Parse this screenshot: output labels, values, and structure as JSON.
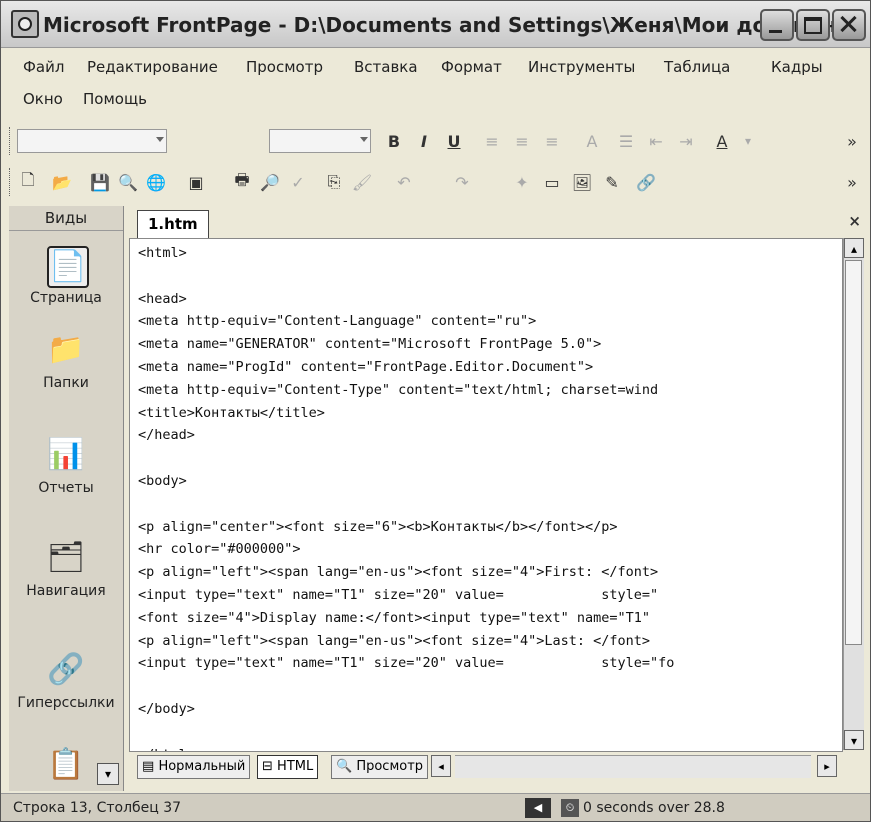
{
  "window": {
    "title": "Microsoft FrontPage - D:\\Documents and Settings\\Женя\\Мои докумен..."
  },
  "menu": {
    "items": [
      "Файл",
      "Редактирование",
      "Просмотр",
      "Вставка",
      "Формат",
      "Инструменты",
      "Таблица",
      "Кадры",
      "Окно",
      "Помощь"
    ]
  },
  "toolbar": {
    "bold": "B",
    "italic": "I",
    "underline": "U",
    "more": "»"
  },
  "views": {
    "header": "Виды",
    "items": [
      {
        "label": "Страница",
        "icon": "page-icon"
      },
      {
        "label": "Папки",
        "icon": "folders-icon"
      },
      {
        "label": "Отчеты",
        "icon": "reports-icon"
      },
      {
        "label": "Навигация",
        "icon": "navigation-icon"
      },
      {
        "label": "Гиперссылки",
        "icon": "hyperlinks-icon"
      }
    ]
  },
  "editor": {
    "tab_label": "1.htm",
    "close_glyph": "×",
    "lines": [
      "<html>",
      "",
      "<head>",
      "<meta http-equiv=\"Content-Language\" content=\"ru\">",
      "<meta name=\"GENERATOR\" content=\"Microsoft FrontPage 5.0\">",
      "<meta name=\"ProgId\" content=\"FrontPage.Editor.Document\">",
      "<meta http-equiv=\"Content-Type\" content=\"text/html; charset=wind",
      "<title>Контакты</title>",
      "</head>",
      "",
      "<body>",
      "",
      "<p align=\"center\"><font size=\"6\"><b>Контакты</b></font></p>",
      "<hr color=\"#000000\">",
      "<p align=\"left\"><span lang=\"en-us\"><font size=\"4\">First: </font>",
      "<input type=\"text\" name=\"T1\" size=\"20\" value=            style=\"",
      "<font size=\"4\">Display name:</font><input type=\"text\" name=\"T1\" ",
      "<p align=\"left\"><span lang=\"en-us\"><font size=\"4\">Last: </font>",
      "<input type=\"text\" name=\"T1\" size=\"20\" value=            style=\"fo",
      "",
      "</body>",
      "",
      "</html>"
    ]
  },
  "view_tabs": {
    "normal": "Нормальный",
    "html": "HTML",
    "preview": "Просмотр"
  },
  "status": {
    "position": "Строка 13, Столбец 37",
    "connection": "0 seconds over 28.8"
  }
}
